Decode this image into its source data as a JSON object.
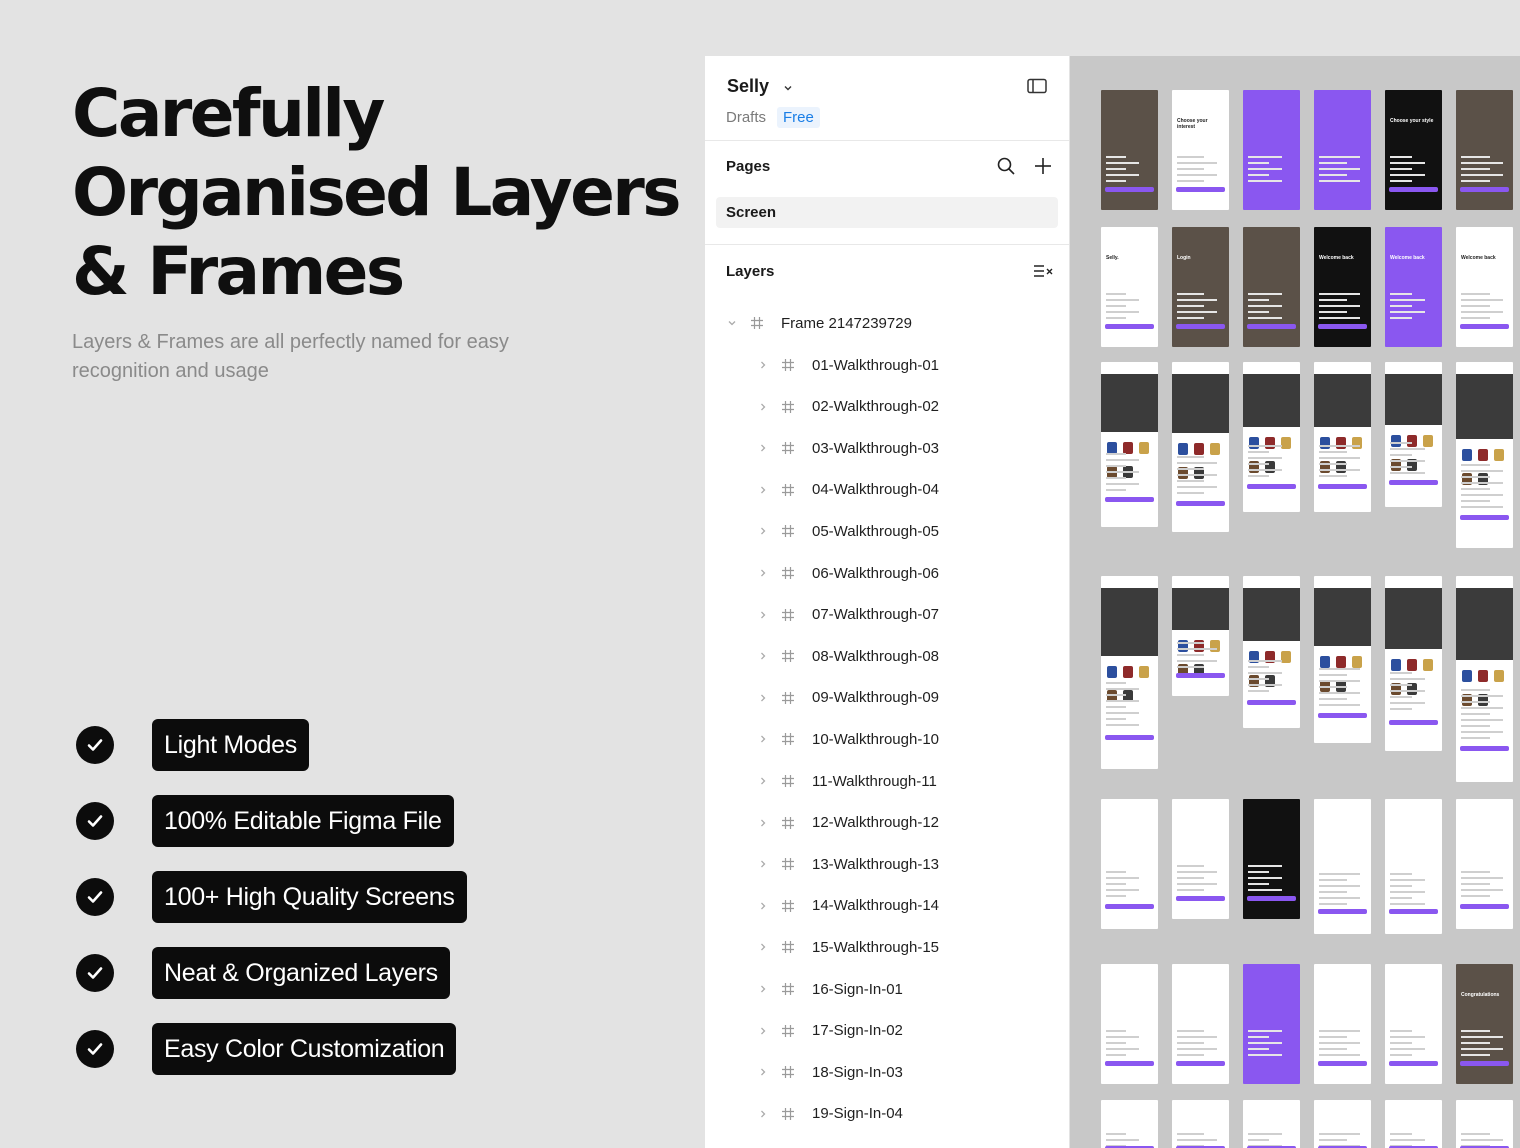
{
  "hero": {
    "title_lines": [
      "Carefully",
      "Organised Layers",
      "& Frames"
    ],
    "subtitle": "Layers & Frames are all perfectly named for easy recognition and usage"
  },
  "features": [
    {
      "label": "Light Modes",
      "icon": "check-icon"
    },
    {
      "label": "100% Editable Figma File",
      "icon": "check-icon"
    },
    {
      "label": "100+ High Quality Screens",
      "icon": "check-icon"
    },
    {
      "label": "Neat & Organized Layers",
      "icon": "check-icon"
    },
    {
      "label": "Easy Color Customization",
      "icon": "check-icon"
    }
  ],
  "panel": {
    "file_name": "Selly",
    "location": "Drafts",
    "plan": "Free",
    "pages_title": "Pages",
    "pages": [
      "Screen"
    ],
    "layers_title": "Layers",
    "root_frame": "Frame 2147239729",
    "layers": [
      "01-Walkthrough-01",
      "02-Walkthrough-02",
      "03-Walkthrough-03",
      "04-Walkthrough-04",
      "05-Walkthrough-05",
      "06-Walkthrough-06",
      "07-Walkthrough-07",
      "08-Walkthrough-08",
      "09-Walkthrough-09",
      "10-Walkthrough-10",
      "11-Walkthrough-11",
      "12-Walkthrough-12",
      "13-Walkthrough-13",
      "14-Walkthrough-14",
      "15-Walkthrough-15",
      "16-Sign-In-01",
      "17-Sign-In-02",
      "18-Sign-In-03",
      "19-Sign-In-04"
    ]
  },
  "canvas": {
    "thumb_texts": [
      "Choose your interest",
      "Choose your style",
      "Selly.",
      "Login",
      "Welcome back",
      "Welcome back",
      "Welcome back",
      "Congratulations"
    ]
  },
  "colors": {
    "background": "#e3e3e3",
    "pill": "#0c0c0c",
    "accent_purple": "#8a57f0",
    "figma_blue": "#1a7ee6"
  }
}
